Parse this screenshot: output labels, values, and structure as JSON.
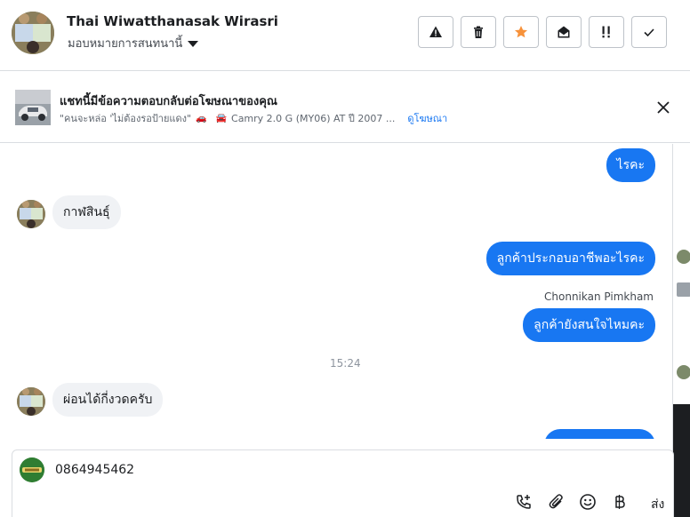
{
  "header": {
    "contact_name": "Thai Wiwatthanasak Wirasri",
    "assign_label": "มอบหมายการสนทนานี้",
    "actions": [
      {
        "name": "report-spam-button",
        "icon": "warning-icon"
      },
      {
        "name": "delete-button",
        "icon": "trash-icon"
      },
      {
        "name": "star-button",
        "icon": "star-icon"
      },
      {
        "name": "mark-unread-button",
        "icon": "envelope-open-icon"
      },
      {
        "name": "follow-up-button",
        "icon": "exclamation-icon"
      },
      {
        "name": "done-button",
        "icon": "check-icon"
      }
    ],
    "avatar_label": "Thai"
  },
  "banner": {
    "title": "แชทนี้มีข้อความตอบกลับต่อโฆษณาของคุณ",
    "ad_text": "\"คนจะหล่อ 'ไม่ต้องรอป้ายแดง\"",
    "ad_car_text": "Camry 2.0 G (MY06) AT ปี 2007 ...",
    "view_ad_link": "ดูโฆษณา"
  },
  "messages": [
    {
      "direction": "out",
      "text": "ไรคะ"
    },
    {
      "direction": "in",
      "text": "กาฬสินธุ์"
    },
    {
      "direction": "out",
      "text": "ลูกค้าประกอบอาชีพอะไรคะ"
    },
    {
      "direction": "out",
      "sender": "Chonnikan Pimkham",
      "text": "ลูกค้ายังสนใจไหมคะ"
    },
    {
      "direction": "in",
      "text": "ผ่อนได้กี่งวดครับ"
    }
  ],
  "timestamp": "15:24",
  "composer": {
    "value": "0864945462",
    "send_label": "ส่ง",
    "tools": [
      "call-add-icon",
      "attachment-icon",
      "emoji-icon",
      "baht-icon"
    ]
  },
  "colors": {
    "accent": "#1877f2",
    "star": "#f7923b",
    "incoming_bubble": "#f0f2f5"
  }
}
